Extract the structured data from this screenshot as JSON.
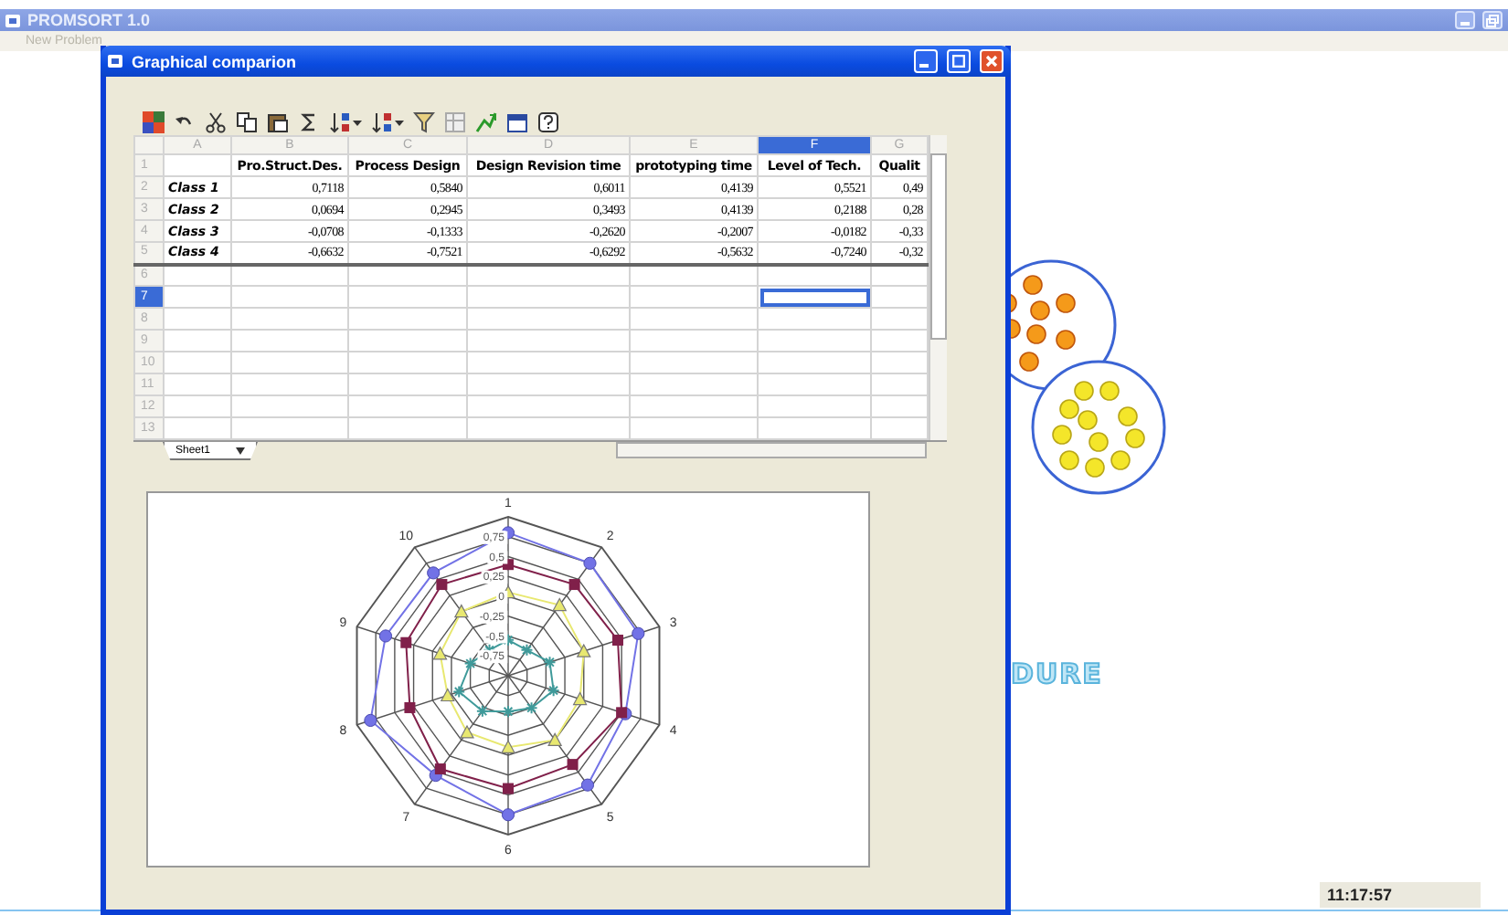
{
  "app": {
    "title": "PROMSORT 1.0",
    "menu": [
      "New Problem"
    ],
    "canvas_text": "DURE",
    "clock": "11:17:57"
  },
  "dialog": {
    "title": "Graphical comparion",
    "sheet": {
      "columns": [
        {
          "label": "A",
          "selected": false
        },
        {
          "label": "B",
          "selected": false
        },
        {
          "label": "C",
          "selected": false
        },
        {
          "label": "D",
          "selected": false
        },
        {
          "label": "E",
          "selected": false
        },
        {
          "label": "F",
          "selected": true
        },
        {
          "label": "G",
          "selected": false
        }
      ],
      "rows": [
        {
          "label": "1",
          "selected": false,
          "cells": [
            null,
            "Pro.Struct.Des.",
            "Process Design",
            "Design Revision time",
            "prototyping time",
            "Level of Tech.",
            "Qualit"
          ]
        },
        {
          "label": "2",
          "selected": false,
          "cells": [
            "Class 1",
            "0,7118",
            "0,5840",
            "0,6011",
            "0,4139",
            "0,5521",
            "0,49"
          ]
        },
        {
          "label": "3",
          "selected": false,
          "cells": [
            "Class 2",
            "0,0694",
            "0,2945",
            "0,3493",
            "0,4139",
            "0,2188",
            "0,28"
          ]
        },
        {
          "label": "4",
          "selected": false,
          "cells": [
            "Class 3",
            "-0,0708",
            "-0,1333",
            "-0,2620",
            "-0,2007",
            "-0,0182",
            "-0,33"
          ]
        },
        {
          "label": "5",
          "selected": false,
          "cells": [
            "Class 4",
            "-0,6632",
            "-0,7521",
            "-0,6292",
            "-0,5632",
            "-0,7240",
            "-0,32"
          ]
        },
        {
          "label": "6",
          "selected": false
        },
        {
          "label": "7",
          "selected": true
        },
        {
          "label": "8",
          "selected": false
        },
        {
          "label": "9",
          "selected": false
        },
        {
          "label": "10",
          "selected": false
        },
        {
          "label": "11",
          "selected": false
        },
        {
          "label": "12",
          "selected": false
        },
        {
          "label": "13",
          "selected": false
        }
      ],
      "tabs": [
        {
          "label": "Sheet1",
          "selected": true
        }
      ]
    },
    "chart": {
      "axis_labels": [
        "1",
        "2",
        "3",
        "4",
        "5",
        "6",
        "7",
        "8",
        "9",
        "10"
      ],
      "tick_labels": [
        "0,75",
        "0,5",
        "0,25",
        "0",
        "-0,25",
        "-0,5",
        "-0,75"
      ],
      "series": [
        {
          "color": "#7272e6",
          "kind": "circle"
        },
        {
          "color": "#80204a",
          "kind": "square"
        },
        {
          "color": "#e8e870",
          "kind": "triangle"
        },
        {
          "color": "#3f9a9a",
          "kind": "star"
        }
      ]
    }
  }
}
